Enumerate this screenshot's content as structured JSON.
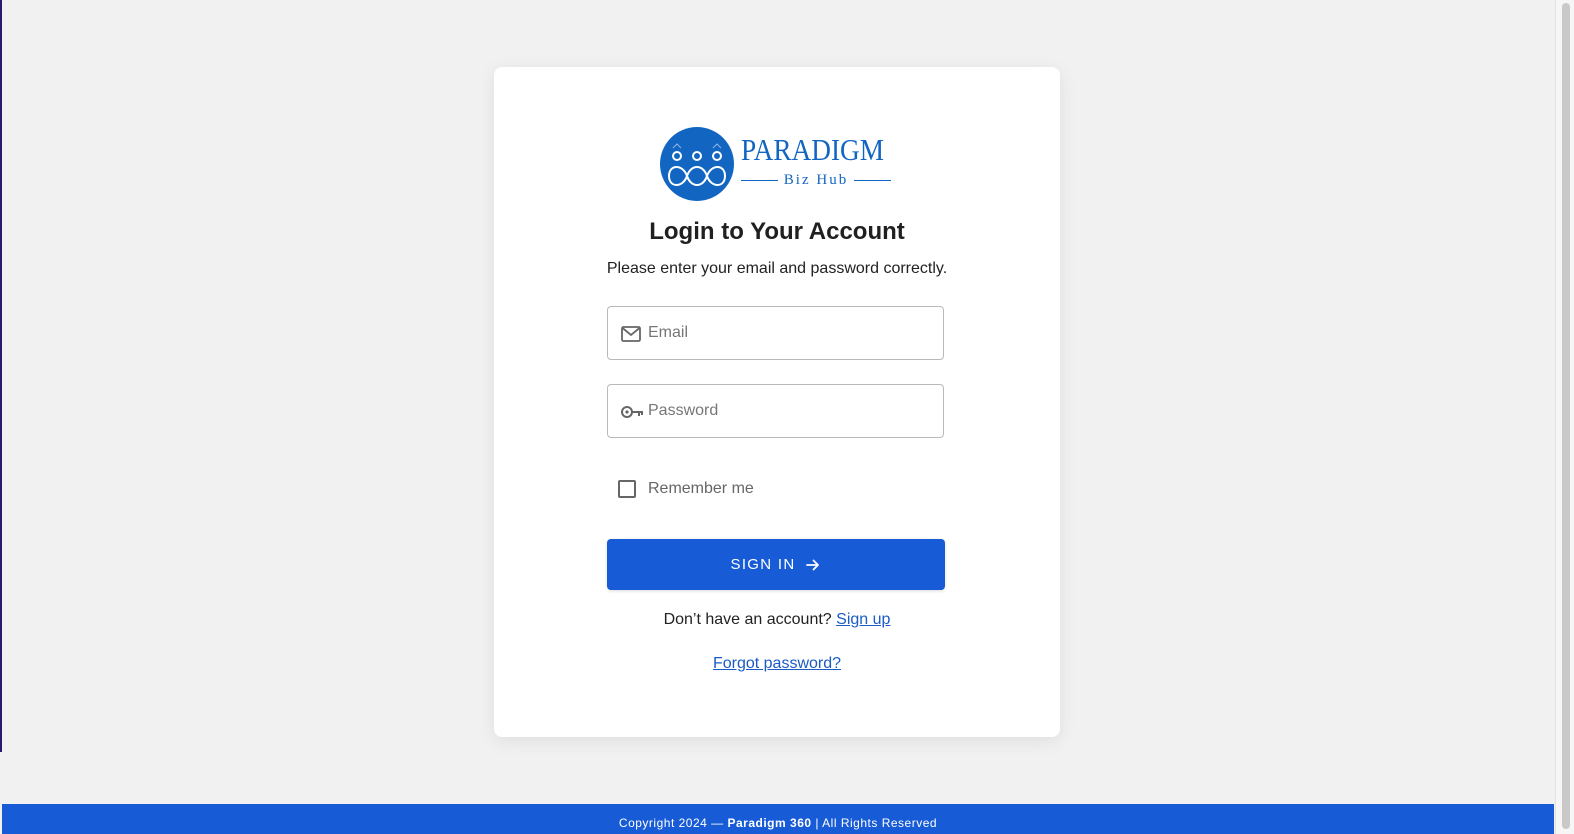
{
  "logo": {
    "word": "PARADIGM",
    "sub": "Biz Hub"
  },
  "login": {
    "title": "Login to Your Account",
    "subtitle": "Please enter your email and password correctly.",
    "email_placeholder": "Email",
    "email_value": "",
    "password_placeholder": "Password",
    "password_value": "",
    "remember_label": "Remember me",
    "remember_checked": false,
    "signin_label": "SIGN IN",
    "no_account_text": "Don’t have an account?",
    "signup_label": "Sign up",
    "forgot_label": "Forgot password?"
  },
  "footer": {
    "prefix": "Copyright 2024 —",
    "brand": "Paradigm 360",
    "suffix": "| All Rights Reserved"
  },
  "icons": {
    "email": "mail-icon",
    "password": "key-icon",
    "signin": "arrow-right-icon"
  },
  "colors": {
    "primary": "#185bd6",
    "logo": "#1266c2",
    "background": "#f1f1f1",
    "card": "#ffffff"
  }
}
